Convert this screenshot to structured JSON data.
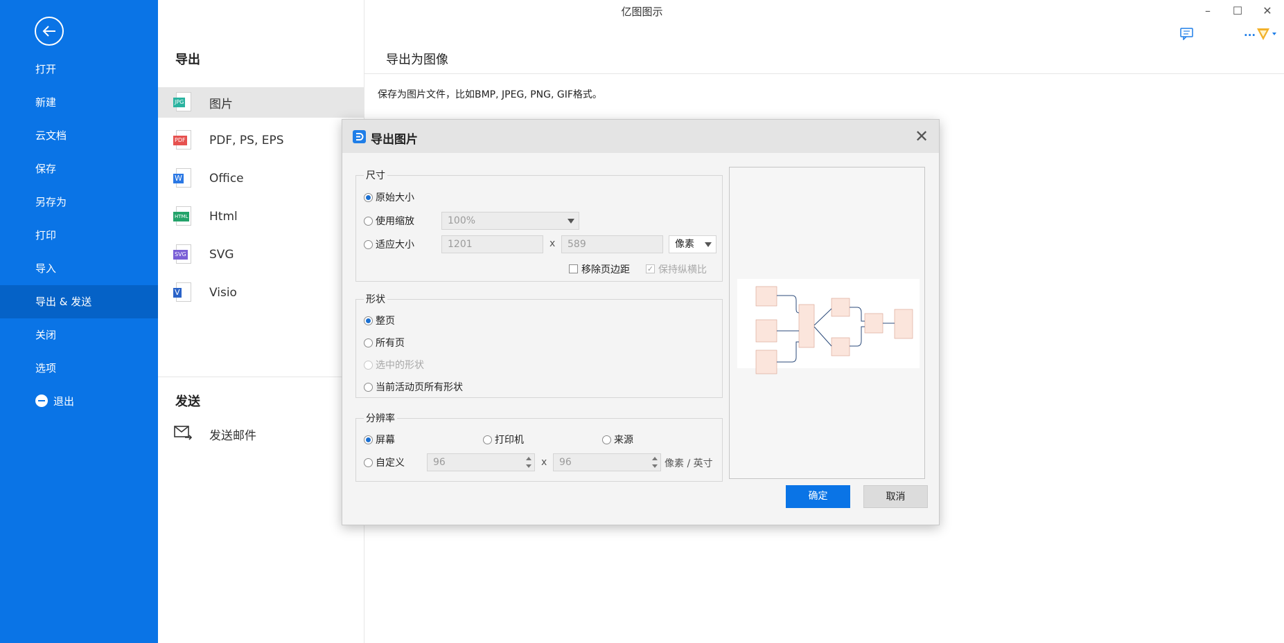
{
  "app": {
    "title": "亿图图示"
  },
  "window_controls": {
    "minimize": "–",
    "maximize": "☐",
    "close": "✕"
  },
  "topbar": {
    "more_label": "..."
  },
  "sidebar": {
    "items": [
      {
        "label": "打开"
      },
      {
        "label": "新建"
      },
      {
        "label": "云文档"
      },
      {
        "label": "保存"
      },
      {
        "label": "另存为"
      },
      {
        "label": "打印"
      },
      {
        "label": "导入"
      },
      {
        "label": "导出 & 发送",
        "active": true
      },
      {
        "label": "关闭"
      },
      {
        "label": "选项"
      },
      {
        "label": "退出"
      }
    ]
  },
  "export_panel": {
    "title": "导出",
    "formats": [
      {
        "label": "图片",
        "tag": "JPG",
        "color": "#2ab3a0",
        "selected": true
      },
      {
        "label": "PDF, PS, EPS",
        "tag": "PDF",
        "color": "#e6514f"
      },
      {
        "label": "Office",
        "tag": "W",
        "color": "#2b78e4"
      },
      {
        "label": "Html",
        "tag": "HTML",
        "color": "#23a36a"
      },
      {
        "label": "SVG",
        "tag": "SVG",
        "color": "#7a5fd6"
      },
      {
        "label": "Visio",
        "tag": "V",
        "color": "#2a63c8"
      }
    ],
    "send_title": "发送",
    "send_items": [
      {
        "label": "发送邮件"
      }
    ]
  },
  "right_panel": {
    "title": "导出为图像",
    "description": "保存为图片文件，比如BMP, JPEG, PNG, GIF格式。"
  },
  "dialog": {
    "title": "导出图片",
    "close": "✕",
    "size_group": {
      "legend": "尺寸",
      "original": "原始大小",
      "use_scale": "使用缩放",
      "scale_value": "100%",
      "fit_size": "适应大小",
      "width": "1201",
      "x": "x",
      "height": "589",
      "unit": "像素",
      "remove_margin": "移除页边距",
      "keep_ratio": "保持纵横比"
    },
    "shape_group": {
      "legend": "形状",
      "whole_page": "整页",
      "all_pages": "所有页",
      "selected_shapes": "选中的形状",
      "current_page_shapes": "当前活动页所有形状"
    },
    "resolution_group": {
      "legend": "分辨率",
      "screen": "屏幕",
      "printer": "打印机",
      "source": "来源",
      "custom": "自定义",
      "dpi_x": "96",
      "x": "x",
      "dpi_y": "96",
      "unit": "像素 / 英寸"
    },
    "ok": "确定",
    "cancel": "取消"
  },
  "colors": {
    "sidebar": "#0a74e6",
    "sidebar_active": "#0562c7",
    "primary_button": "#0a74e6"
  }
}
